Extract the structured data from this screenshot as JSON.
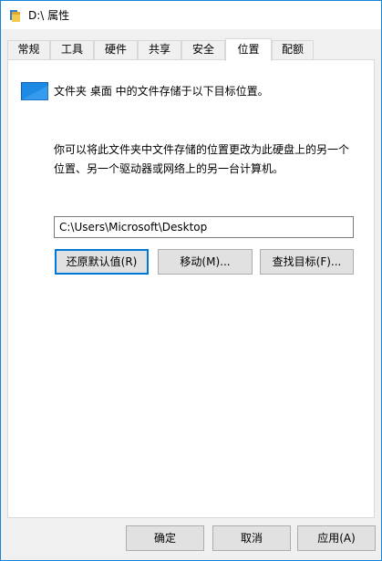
{
  "window": {
    "title": "D:\\ 属性",
    "icon": "drive-icon"
  },
  "tabs": [
    {
      "label": "常规",
      "active": false
    },
    {
      "label": "工具",
      "active": false
    },
    {
      "label": "硬件",
      "active": false
    },
    {
      "label": "共享",
      "active": false
    },
    {
      "label": "安全",
      "active": false
    },
    {
      "label": "位置",
      "active": true
    },
    {
      "label": "配额",
      "active": false
    }
  ],
  "location": {
    "folder_icon": "desktop-folder-icon",
    "intro": "文件夹 桌面 中的文件存储于以下目标位置。",
    "description_line1": "你可以将此文件夹中文件存储的位置更改为此硬盘上的另一个",
    "description_line2": "位置、另一个驱动器或网络上的另一台计算机。",
    "path_value": "C:\\Users\\Microsoft\\Desktop",
    "restore_default_label": "还原默认值(R)",
    "move_label": "移动(M)...",
    "find_target_label": "查找目标(F)..."
  },
  "footer": {
    "ok_label": "确定",
    "cancel_label": "取消",
    "apply_label": "应用(A)"
  },
  "colors": {
    "accent": "#0078d7",
    "window_border": "#1883d7",
    "folder_blue": "#1e8ae6"
  }
}
